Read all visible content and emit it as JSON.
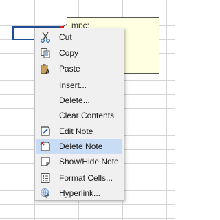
{
  "note": {
    "text": "mpc:"
  },
  "menu": {
    "items": [
      {
        "label": "Cut",
        "icon": "scissors-icon"
      },
      {
        "label": "Copy",
        "icon": "copy-icon"
      },
      {
        "label": "Paste",
        "icon": "paste-icon"
      },
      {
        "label": "Insert..."
      },
      {
        "label": "Delete..."
      },
      {
        "label": "Clear Contents"
      },
      {
        "label": "Edit Note",
        "icon": "edit-note-icon"
      },
      {
        "label": "Delete Note",
        "icon": "delete-note-icon",
        "highlighted": true
      },
      {
        "label": "Show/Hide Note",
        "icon": "show-hide-note-icon"
      },
      {
        "label": "Format Cells...",
        "icon": "format-cells-icon"
      },
      {
        "label": "Hyperlink...",
        "icon": "hyperlink-icon"
      }
    ]
  },
  "colors": {
    "selection_border": "#1f4e96",
    "note_background": "#ffffe1",
    "menu_highlight": "#c9dcf5",
    "comment_indicator": "#e02020"
  }
}
